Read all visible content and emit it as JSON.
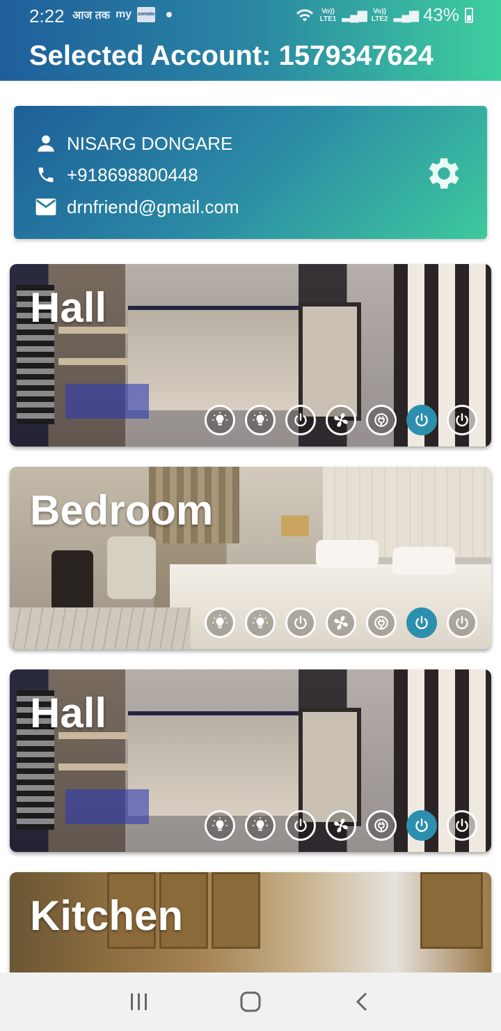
{
  "status_bar": {
    "time": "2:22",
    "left_icons": [
      "आज तक",
      "my"
    ],
    "zomato_label": "zomato",
    "network_1": "Vo))\nLTE1",
    "network_2": "Vo))\nLTE2",
    "battery": "43%"
  },
  "header": {
    "title": "Selected Account: 1579347624"
  },
  "account": {
    "name": "NISARG DONGARE",
    "phone": "+918698800448",
    "email": "drnfriend@gmail.com"
  },
  "rooms": [
    {
      "name": "Hall",
      "scene": "hall"
    },
    {
      "name": "Bedroom",
      "scene": "bedroom"
    },
    {
      "name": "Hall",
      "scene": "hall"
    },
    {
      "name": "Kitchen",
      "scene": "kitchen"
    }
  ],
  "devices": [
    {
      "icon": "bulb-icon",
      "active": false
    },
    {
      "icon": "bulb-icon",
      "active": false
    },
    {
      "icon": "power-icon",
      "active": false
    },
    {
      "icon": "fan-icon",
      "active": false
    },
    {
      "icon": "plug-icon",
      "active": false
    },
    {
      "icon": "power-icon",
      "active": true
    },
    {
      "icon": "power-icon",
      "active": false
    }
  ],
  "colors": {
    "gradient_start": "#1e5f9c",
    "gradient_end": "#3ecf9e",
    "active_device": "#2c8fae"
  },
  "navbar": [
    "recent-apps-icon",
    "home-icon",
    "back-icon"
  ]
}
